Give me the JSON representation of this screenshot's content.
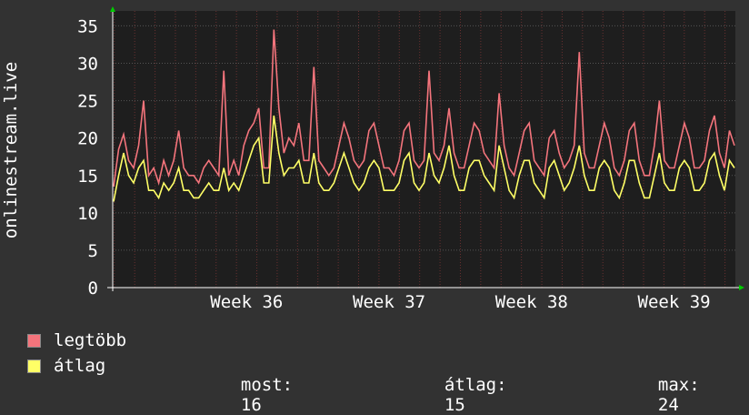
{
  "colors": {
    "legtobb": "#f4747c",
    "atlag": "#ffff66",
    "background": "#323232",
    "plot_bg": "#1e1e1e"
  },
  "legend": {
    "series1": "legtöbb",
    "series2": "átlag"
  },
  "stats": {
    "most_label": "most:",
    "most_value": "16",
    "atlag_label": "átlag:",
    "atlag_value": "15",
    "max_label": "max:",
    "max_value": "24"
  },
  "chart_data": {
    "type": "line",
    "ylabel": "onlinestream.live",
    "ylim": [
      0,
      37
    ],
    "yticks": [
      0,
      5,
      10,
      15,
      20,
      25,
      30,
      35
    ],
    "x_range_weeks": [
      35.56,
      39.93
    ],
    "x_ticks": [
      {
        "week": 36,
        "label": "Week 36"
      },
      {
        "week": 37,
        "label": "Week 37"
      },
      {
        "week": 38,
        "label": "Week 38"
      },
      {
        "week": 39,
        "label": "Week 39"
      }
    ],
    "grid": true,
    "series": [
      {
        "name": "legtöbb",
        "values": [
          13.5,
          18.5,
          20.5,
          17,
          16,
          19,
          25,
          15,
          16,
          14,
          17,
          15,
          17,
          21,
          16,
          15,
          15,
          14,
          16,
          17,
          16,
          15,
          29,
          15,
          17,
          15,
          19,
          21,
          22,
          24,
          16,
          16,
          34.5,
          24,
          18,
          20,
          19,
          22,
          17,
          17,
          29.5,
          17,
          16,
          15,
          16,
          19,
          22,
          20,
          17,
          16,
          17,
          21,
          22,
          19,
          16,
          16,
          15,
          17,
          21,
          22,
          17,
          16,
          17,
          29,
          18,
          17,
          19,
          24,
          18,
          16,
          16,
          19,
          22,
          21,
          18,
          17,
          16,
          26,
          19,
          16,
          15,
          18,
          21,
          22,
          17,
          16,
          15,
          20,
          21,
          18,
          16,
          17,
          19,
          31.5,
          18,
          16,
          16,
          19,
          22,
          20,
          16,
          15,
          17,
          21,
          22,
          17,
          15,
          15,
          19,
          25,
          17,
          16,
          16,
          19,
          22,
          20,
          16,
          16,
          17,
          21,
          23,
          18,
          16,
          21,
          19
        ]
      },
      {
        "name": "átlag",
        "values": [
          11.5,
          15,
          18,
          15,
          14,
          16,
          17,
          13,
          13,
          12,
          14,
          13,
          14,
          16,
          13,
          13,
          12,
          12,
          13,
          14,
          13,
          13,
          16,
          13,
          14,
          13,
          15,
          17,
          19,
          20,
          14,
          14,
          23,
          18,
          15,
          16,
          16,
          17,
          14,
          14,
          18,
          14,
          13,
          13,
          14,
          16,
          18,
          16,
          14,
          13,
          14,
          16,
          17,
          16,
          13,
          13,
          13,
          14,
          17,
          18,
          14,
          13,
          14,
          18,
          15,
          14,
          16,
          19,
          15,
          13,
          13,
          16,
          17,
          17,
          15,
          14,
          13,
          19,
          16,
          13,
          12,
          15,
          17,
          17,
          14,
          13,
          12,
          16,
          17,
          15,
          13,
          14,
          16,
          19,
          15,
          13,
          13,
          16,
          17,
          16,
          13,
          12,
          14,
          17,
          17,
          14,
          12,
          12,
          15,
          18,
          14,
          13,
          13,
          16,
          17,
          16,
          13,
          13,
          14,
          17,
          18,
          15,
          13,
          17,
          16
        ]
      }
    ]
  }
}
